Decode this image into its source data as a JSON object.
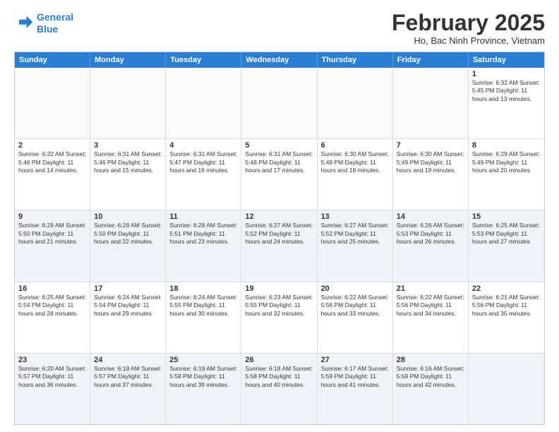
{
  "header": {
    "logo_line1": "General",
    "logo_line2": "Blue",
    "title": "February 2025",
    "subtitle": "Ho, Bac Ninh Province, Vietnam"
  },
  "days_of_week": [
    "Sunday",
    "Monday",
    "Tuesday",
    "Wednesday",
    "Thursday",
    "Friday",
    "Saturday"
  ],
  "rows": [
    {
      "alt": false,
      "cells": [
        {
          "day": "",
          "info": ""
        },
        {
          "day": "",
          "info": ""
        },
        {
          "day": "",
          "info": ""
        },
        {
          "day": "",
          "info": ""
        },
        {
          "day": "",
          "info": ""
        },
        {
          "day": "",
          "info": ""
        },
        {
          "day": "1",
          "info": "Sunrise: 6:32 AM\nSunset: 5:45 PM\nDaylight: 11 hours\nand 13 minutes."
        }
      ]
    },
    {
      "alt": false,
      "cells": [
        {
          "day": "2",
          "info": "Sunrise: 6:32 AM\nSunset: 5:46 PM\nDaylight: 11 hours\nand 14 minutes."
        },
        {
          "day": "3",
          "info": "Sunrise: 6:31 AM\nSunset: 5:46 PM\nDaylight: 11 hours\nand 15 minutes."
        },
        {
          "day": "4",
          "info": "Sunrise: 6:31 AM\nSunset: 5:47 PM\nDaylight: 11 hours\nand 16 minutes."
        },
        {
          "day": "5",
          "info": "Sunrise: 6:31 AM\nSunset: 5:48 PM\nDaylight: 11 hours\nand 17 minutes."
        },
        {
          "day": "6",
          "info": "Sunrise: 6:30 AM\nSunset: 5:48 PM\nDaylight: 11 hours\nand 18 minutes."
        },
        {
          "day": "7",
          "info": "Sunrise: 6:30 AM\nSunset: 5:49 PM\nDaylight: 11 hours\nand 19 minutes."
        },
        {
          "day": "8",
          "info": "Sunrise: 6:29 AM\nSunset: 5:49 PM\nDaylight: 11 hours\nand 20 minutes."
        }
      ]
    },
    {
      "alt": true,
      "cells": [
        {
          "day": "9",
          "info": "Sunrise: 6:29 AM\nSunset: 5:50 PM\nDaylight: 11 hours\nand 21 minutes."
        },
        {
          "day": "10",
          "info": "Sunrise: 6:28 AM\nSunset: 5:50 PM\nDaylight: 11 hours\nand 22 minutes."
        },
        {
          "day": "11",
          "info": "Sunrise: 6:28 AM\nSunset: 5:51 PM\nDaylight: 11 hours\nand 23 minutes."
        },
        {
          "day": "12",
          "info": "Sunrise: 6:27 AM\nSunset: 5:52 PM\nDaylight: 11 hours\nand 24 minutes."
        },
        {
          "day": "13",
          "info": "Sunrise: 6:27 AM\nSunset: 5:52 PM\nDaylight: 11 hours\nand 25 minutes."
        },
        {
          "day": "14",
          "info": "Sunrise: 6:26 AM\nSunset: 5:53 PM\nDaylight: 11 hours\nand 26 minutes."
        },
        {
          "day": "15",
          "info": "Sunrise: 6:25 AM\nSunset: 5:53 PM\nDaylight: 11 hours\nand 27 minutes."
        }
      ]
    },
    {
      "alt": false,
      "cells": [
        {
          "day": "16",
          "info": "Sunrise: 6:25 AM\nSunset: 5:54 PM\nDaylight: 11 hours\nand 28 minutes."
        },
        {
          "day": "17",
          "info": "Sunrise: 6:24 AM\nSunset: 5:54 PM\nDaylight: 11 hours\nand 29 minutes."
        },
        {
          "day": "18",
          "info": "Sunrise: 6:24 AM\nSunset: 5:55 PM\nDaylight: 11 hours\nand 30 minutes."
        },
        {
          "day": "19",
          "info": "Sunrise: 6:23 AM\nSunset: 5:55 PM\nDaylight: 11 hours\nand 32 minutes."
        },
        {
          "day": "20",
          "info": "Sunrise: 6:22 AM\nSunset: 5:56 PM\nDaylight: 11 hours\nand 33 minutes."
        },
        {
          "day": "21",
          "info": "Sunrise: 6:22 AM\nSunset: 5:56 PM\nDaylight: 11 hours\nand 34 minutes."
        },
        {
          "day": "22",
          "info": "Sunrise: 6:21 AM\nSunset: 5:56 PM\nDaylight: 11 hours\nand 35 minutes."
        }
      ]
    },
    {
      "alt": true,
      "cells": [
        {
          "day": "23",
          "info": "Sunrise: 6:20 AM\nSunset: 5:57 PM\nDaylight: 11 hours\nand 36 minutes."
        },
        {
          "day": "24",
          "info": "Sunrise: 6:19 AM\nSunset: 5:57 PM\nDaylight: 11 hours\nand 37 minutes."
        },
        {
          "day": "25",
          "info": "Sunrise: 6:19 AM\nSunset: 5:58 PM\nDaylight: 11 hours\nand 39 minutes."
        },
        {
          "day": "26",
          "info": "Sunrise: 6:18 AM\nSunset: 5:58 PM\nDaylight: 11 hours\nand 40 minutes."
        },
        {
          "day": "27",
          "info": "Sunrise: 6:17 AM\nSunset: 5:59 PM\nDaylight: 11 hours\nand 41 minutes."
        },
        {
          "day": "28",
          "info": "Sunrise: 6:16 AM\nSunset: 5:59 PM\nDaylight: 11 hours\nand 42 minutes."
        },
        {
          "day": "",
          "info": ""
        }
      ]
    }
  ]
}
